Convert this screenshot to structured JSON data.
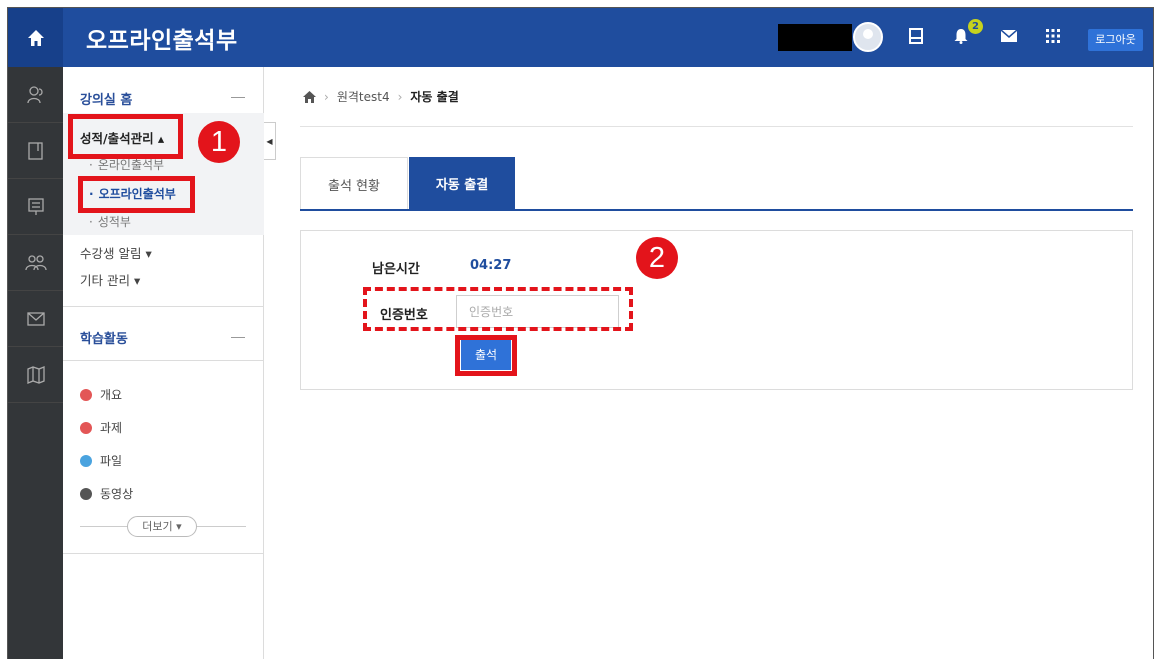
{
  "header": {
    "title": "오프라인출석부",
    "logout_label": "로그아웃",
    "notification_count": "2",
    "home_icon": "home-icon",
    "icons": [
      "profile-avatar",
      "bookmark-icon",
      "bell-icon",
      "mail-icon",
      "grid-icon"
    ]
  },
  "rail": {
    "icons": [
      "people-icon",
      "book-icon",
      "board-icon",
      "group-icon",
      "mail-icon",
      "map-icon"
    ]
  },
  "sidebar": {
    "home_label": "강의실 홈",
    "grade_menu": "성적/출석관리 ▴",
    "grade_items": [
      "온라인출석부",
      "오프라인출석부",
      "성적부"
    ],
    "notice_menu": "수강생 알림 ▾",
    "etc_menu": "기타 관리 ▾",
    "activity_label": "학습활동",
    "activities": [
      {
        "label": "개요",
        "color": "#e35656"
      },
      {
        "label": "과제",
        "color": "#e35656"
      },
      {
        "label": "파일",
        "color": "#4aa3df"
      },
      {
        "label": "동영상",
        "color": "#555555"
      }
    ],
    "more_label": "더보기 ▾"
  },
  "breadcrumb": {
    "course": "원격test4",
    "current": "자동 출결"
  },
  "tabs": [
    {
      "label": "출석 현황"
    },
    {
      "label": "자동 출결"
    }
  ],
  "form": {
    "remaining_label": "남은시간",
    "remaining_value": "04:27",
    "code_label": "인증번호",
    "code_placeholder": "인증번호",
    "submit_label": "출석"
  },
  "annotations": {
    "step1": "1",
    "step2": "2",
    "color": "#e3141b"
  },
  "colors": {
    "header": "#1f4d9e",
    "rail": "#333639",
    "accent": "#2f72d8"
  }
}
